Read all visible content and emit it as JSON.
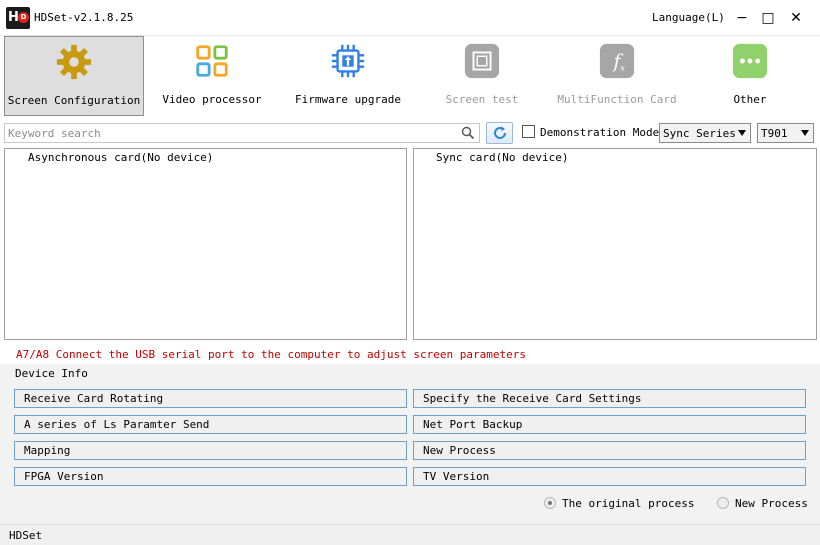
{
  "window": {
    "title": "HDSet-v2.1.8.25",
    "logo_letters": "HD",
    "language": "Language(L)",
    "minimize": "−",
    "maximize": "□",
    "close": "✕"
  },
  "toolbar": [
    {
      "label": "Screen Configuration",
      "icon": "gear-icon",
      "active": true,
      "enabled": true
    },
    {
      "label": "Video processor",
      "icon": "grid-icon",
      "active": false,
      "enabled": true
    },
    {
      "label": "Firmware upgrade",
      "icon": "chip-upload-icon",
      "active": false,
      "enabled": true
    },
    {
      "label": "Screen test",
      "icon": "screen-test-icon",
      "active": false,
      "enabled": false
    },
    {
      "label": "MultiFunction Card",
      "icon": "function-icon",
      "active": false,
      "enabled": false
    },
    {
      "label": "Other",
      "icon": "more-icon",
      "active": false,
      "enabled": true
    }
  ],
  "colors": {
    "gear": "#c79a12",
    "grid_orange": "#f5a623",
    "grid_green": "#7cc242",
    "grid_blue": "#4aa8e0",
    "chip_blue": "#2f7fe6",
    "disabled_gray": "#a6a6a6",
    "other_green": "#8fd16a",
    "hint_red": "#c00000"
  },
  "search": {
    "placeholder": "Keyword search",
    "demo_mode_label": "Demonstration Mode",
    "demo_mode_checked": false,
    "series_select": "Sync Series",
    "model_select": "T901"
  },
  "panels": {
    "async": "Asynchronous card(No device)",
    "sync": "Sync card(No device)"
  },
  "hint": "A7/A8 Connect the USB serial port to the computer to adjust screen parameters",
  "device_info": {
    "title": "Device Info",
    "left_buttons": [
      "Receive Card Rotating",
      "A series of Ls Paramter Send",
      "Mapping",
      "FPGA Version"
    ],
    "right_buttons": [
      "Specify the Receive Card Settings",
      "Net Port Backup",
      "New Process",
      "TV Version"
    ],
    "radio_original": "The original process",
    "radio_new": "New Process",
    "selected": "original"
  },
  "status": "HDSet"
}
